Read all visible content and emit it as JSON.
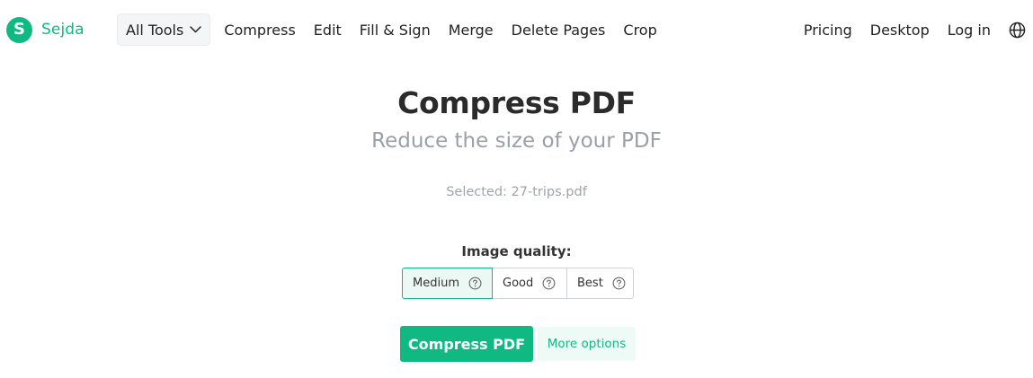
{
  "brand": {
    "logo_letter": "S",
    "name": "Sejda",
    "color": "#10b981"
  },
  "nav": {
    "all_tools": "All Tools",
    "links": [
      "Compress",
      "Edit",
      "Fill & Sign",
      "Merge",
      "Delete Pages",
      "Crop"
    ],
    "right": [
      "Pricing",
      "Desktop",
      "Log in"
    ],
    "icons": {
      "all_tools_chevron": "chevron-down-icon",
      "language": "globe-icon"
    }
  },
  "main": {
    "title": "Compress PDF",
    "subtitle": "Reduce the size of your PDF",
    "selected_file": "Selected: 27-trips.pdf",
    "quality_label": "Image quality:",
    "quality_options": [
      {
        "label": "Medium",
        "selected": true,
        "icon": "help-icon"
      },
      {
        "label": "Good",
        "selected": false,
        "icon": "help-icon"
      },
      {
        "label": "Best",
        "selected": false,
        "icon": "help-icon"
      }
    ],
    "compress_button": "Compress PDF",
    "more_options": "More options"
  },
  "colors": {
    "accent": "#10b981",
    "accent_light": "#eefaf5",
    "title": "#2b2b2b",
    "muted": "#9aa0a6"
  }
}
